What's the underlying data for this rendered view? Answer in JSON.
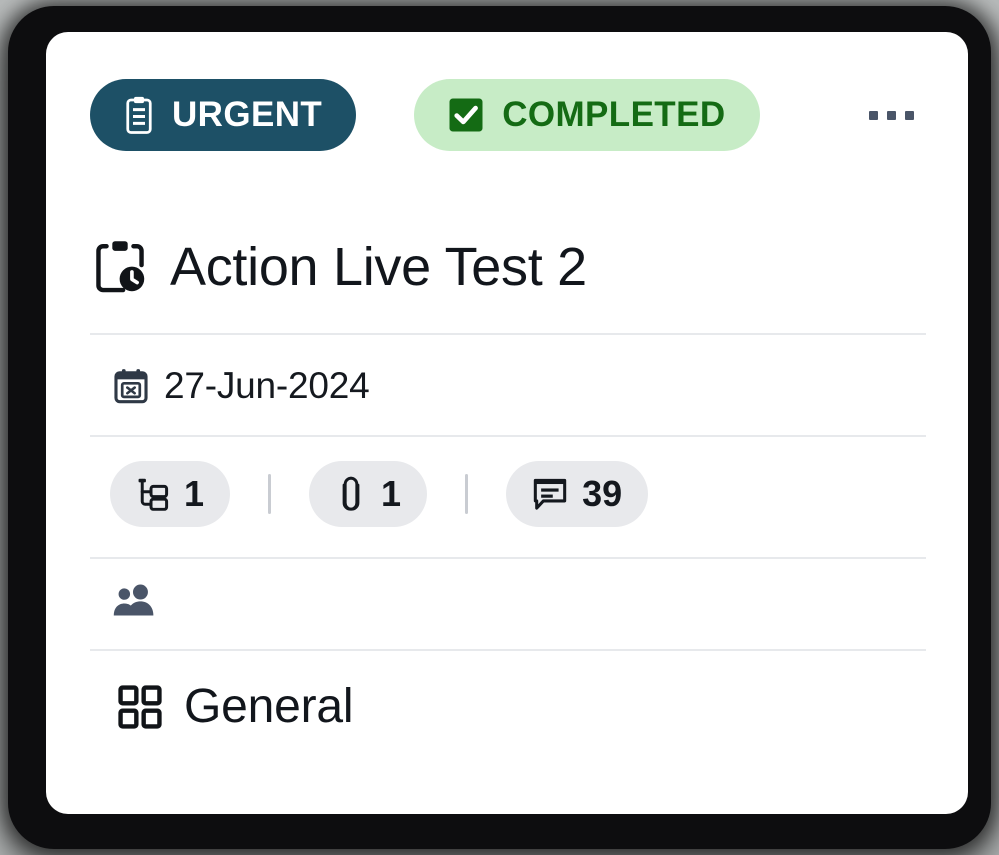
{
  "card": {
    "badges": [
      {
        "id": "urgent",
        "label": "URGENT",
        "icon": "clipboard-list-icon",
        "bg": "#1d5066",
        "fg": "#ffffff"
      },
      {
        "id": "completed",
        "label": "COMPLETED",
        "icon": "checkbox-checked-icon",
        "bg": "#c7ecc6",
        "fg": "#146b14"
      }
    ],
    "overflow_menu": {
      "icon": "ellipsis-horizontal-icon",
      "label": "..."
    },
    "title": {
      "icon": "clipboard-clock-icon",
      "text": "Action Live Test 2"
    },
    "due_date": {
      "icon": "calendar-x-icon",
      "text": "27-Jun-2024"
    },
    "stats": [
      {
        "id": "subtasks",
        "icon": "subtask-tree-icon",
        "value": "1"
      },
      {
        "id": "attachments",
        "icon": "paperclip-icon",
        "value": "1"
      },
      {
        "id": "comments",
        "icon": "comment-lines-icon",
        "value": "39"
      }
    ],
    "assignees": {
      "icon": "people-group-icon"
    },
    "category": {
      "icon": "grid-four-squares-icon",
      "text": "General"
    }
  },
  "colors": {
    "urgent_bg": "#1d5066",
    "completed_bg": "#c7ecc6",
    "completed_fg": "#146b14",
    "chip_bg": "#e8e9ec",
    "divider": "#e7e9ec",
    "text": "#12161c",
    "icon_slate": "#4a5568"
  }
}
